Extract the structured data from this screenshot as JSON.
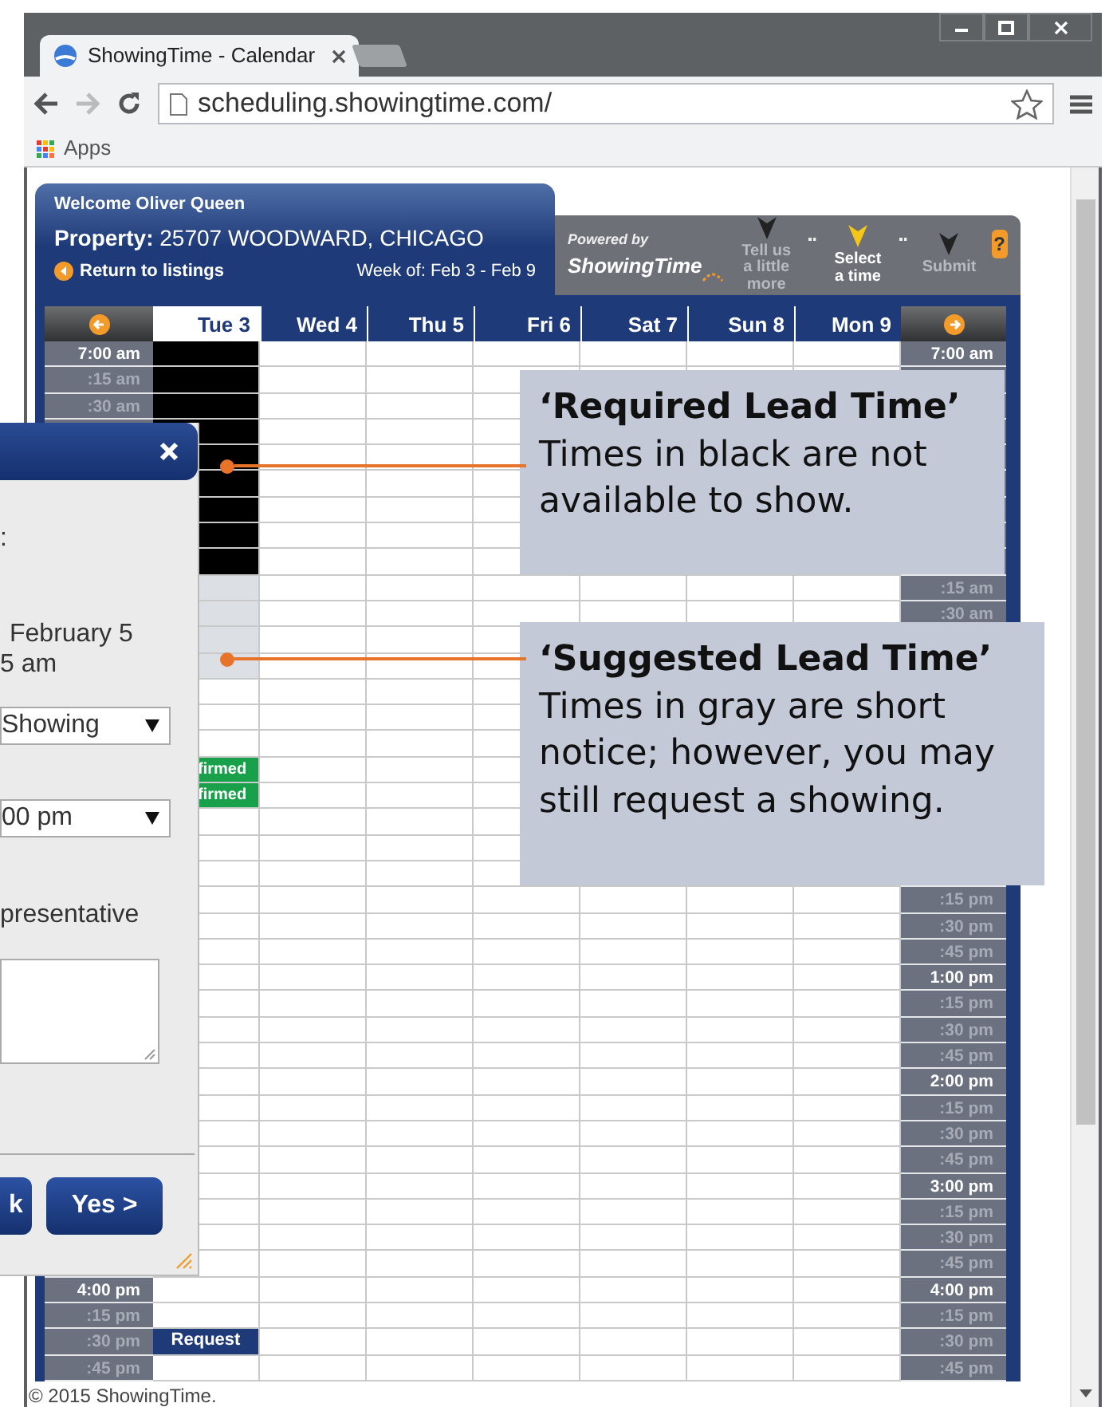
{
  "browser": {
    "tab_title": "ShowingTime - Calendar",
    "url": "scheduling.showingtime.com/",
    "bookmark": "Apps"
  },
  "header": {
    "welcome": "Welcome Oliver Queen",
    "property": "**Property:** 25707 WOODWARD, CHICAGO",
    "return_link": "Return to listings",
    "week": "Week of: Feb 3 - Feb 9",
    "powered_by": "Powered by",
    "brand": "ShowingTime",
    "help": "?",
    "steps": [
      {
        "label": "Tell us a little more",
        "selected": false
      },
      {
        "label": "Select a time",
        "selected": true
      },
      {
        "label": "Submit",
        "selected": false
      }
    ]
  },
  "calendar": {
    "days": [
      {
        "label": "Tue 3",
        "selected": true
      },
      {
        "label": "Wed 4",
        "selected": false
      },
      {
        "label": "Thu 5",
        "selected": false
      },
      {
        "label": "Fri 6",
        "selected": false
      },
      {
        "label": "Sat 7",
        "selected": false
      },
      {
        "label": "Sun 8",
        "selected": false
      },
      {
        "label": "Mon 9",
        "selected": false
      }
    ],
    "rows": [
      {
        "kind": "hour",
        "left": "7:00 am",
        "right": "7:00 am",
        "tue": {
          "kind": "required"
        }
      },
      {
        "kind": "quarter",
        "left": ":15 am",
        "tue": {
          "kind": "required"
        }
      },
      {
        "kind": "quarter",
        "left": ":30 am",
        "tue": {
          "kind": "required"
        }
      },
      {
        "kind": "quarter",
        "tue": {
          "kind": "required"
        }
      },
      {
        "kind": "hour",
        "tue": {
          "kind": "required"
        }
      },
      {
        "kind": "quarter",
        "tue": {
          "kind": "required"
        }
      },
      {
        "kind": "quarter",
        "tue": {
          "kind": "required"
        }
      },
      {
        "kind": "quarter",
        "tue": {
          "kind": "required"
        }
      },
      {
        "kind": "hour",
        "tue": {
          "kind": "required"
        }
      },
      {
        "kind": "quarter",
        "right": ":15 am",
        "tue": {
          "kind": "suggested"
        }
      },
      {
        "kind": "quarter",
        "right": ":30 am",
        "tue": {
          "kind": "suggested"
        }
      },
      {
        "kind": "quarter",
        "tue": {
          "kind": "suggested"
        }
      },
      {
        "kind": "hour",
        "tue": {
          "kind": "suggested"
        }
      },
      {
        "kind": "quarter"
      },
      {
        "kind": "quarter"
      },
      {
        "kind": "quarter"
      },
      {
        "kind": "hour",
        "tue": {
          "kind": "confirmed",
          "text": "firmed"
        }
      },
      {
        "kind": "quarter",
        "tue": {
          "kind": "confirmed",
          "text": "firmed"
        }
      },
      {
        "kind": "quarter"
      },
      {
        "kind": "quarter"
      },
      {
        "kind": "hour"
      },
      {
        "kind": "quarter",
        "right": ":15 pm"
      },
      {
        "kind": "quarter",
        "right": ":30 pm"
      },
      {
        "kind": "quarter",
        "right": ":45 pm"
      },
      {
        "kind": "hour",
        "right": "1:00 pm"
      },
      {
        "kind": "quarter",
        "right": ":15 pm"
      },
      {
        "kind": "quarter",
        "right": ":30 pm"
      },
      {
        "kind": "quarter",
        "right": ":45 pm"
      },
      {
        "kind": "hour",
        "right": "2:00 pm"
      },
      {
        "kind": "quarter",
        "right": ":15 pm"
      },
      {
        "kind": "quarter",
        "right": ":30 pm"
      },
      {
        "kind": "quarter",
        "right": ":45 pm"
      },
      {
        "kind": "hour",
        "right": "3:00 pm"
      },
      {
        "kind": "quarter",
        "right": ":15 pm"
      },
      {
        "kind": "quarter",
        "right": ":30 pm"
      },
      {
        "kind": "quarter",
        "right": ":45 pm"
      },
      {
        "kind": "hour",
        "left": "4:00 pm",
        "right": "4:00 pm"
      },
      {
        "kind": "quarter",
        "left": ":15 pm",
        "right": ":15 pm"
      },
      {
        "kind": "quarter",
        "left": ":30 pm",
        "right": ":30 pm",
        "tue": {
          "kind": "request",
          "text": "Request"
        }
      },
      {
        "kind": "quarter",
        "left": ":45 pm",
        "right": ":45 pm"
      }
    ]
  },
  "dialog": {
    "label_tail": ":",
    "date": "February 5",
    "time": "5 am",
    "type_select": "Showing",
    "end_select": "00 pm",
    "rep_label": "presentative",
    "back_button": "k",
    "yes_button": "Yes >"
  },
  "callouts": [
    {
      "title": "‘Required Lead Time’",
      "text": "Times in black are not available to show."
    },
    {
      "title": "‘Suggested Lead Time’",
      "text": "Times in gray are short notice; however, you may still request a showing."
    }
  ],
  "footer": "© 2015 ShowingTime."
}
